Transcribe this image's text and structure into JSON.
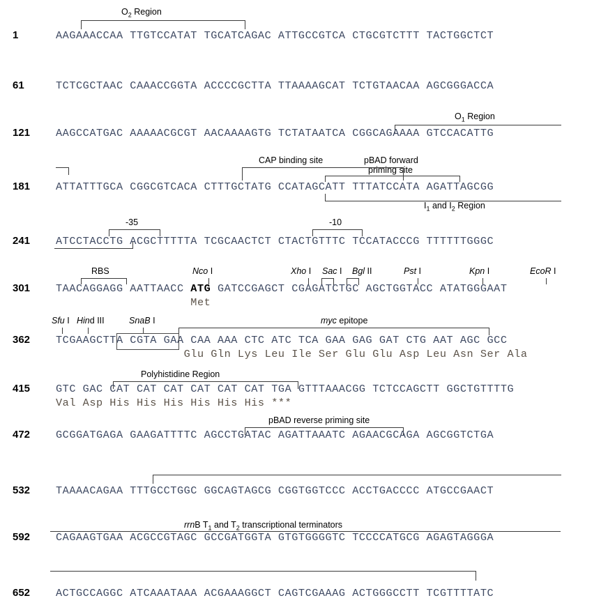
{
  "document": {
    "type": "dna-sequence-map",
    "title": "pBAD vector multiple cloning site sequence"
  },
  "sequence_lines": [
    {
      "number": "1",
      "bases": "AAGAAACCAA TTGTCCATAT TGCATCAGAC ATTGCCGTCA CTGCGTCTTT TACTGGCTCT"
    },
    {
      "number": "61",
      "bases": "TCTCGCTAAC CAAACCGGTA ACCCCGCTTA TTAAAAGCAT TCTGTAACAA AGCGGGACCA"
    },
    {
      "number": "121",
      "bases": "AAGCCATGAC AAAAACGCGT AACAAAAGTG TCTATAATCA CGGCAGAAAA GTCCACATTG"
    },
    {
      "number": "181",
      "bases": "ATTATTTGCA CGGCGTCACA CTTTGCTATG CCATAGCATT TTTATCCATA AGATTAGCGG"
    },
    {
      "number": "241",
      "bases": "ATCCTACCTG ACGCTTTTTA TCGCAACTCT CTACTGTTTC TCCATACCCG TTTTTTGGGC"
    },
    {
      "number": "301",
      "bases_html": "TAACAGGAGG AATTAACC <b>ATG</b> GATCCGAGCT CGAGATCTGC AGCTGGTACC ATATGGGAAT",
      "bases": "TAACAGGAGG AATTAACC ATG GATCCGAGCT CGAGATCTGC AGCTGGTACC ATATGGGAAT",
      "amino_acids": "                    Met"
    },
    {
      "number": "362",
      "bases": "TCGAAGCTTA CGTA GAA CAA AAA CTC ATC TCA GAA GAG GAT CTG AAT AGC GCC",
      "amino_acids": "                   Glu Gln Lys Leu Ile Ser Glu Glu Asp Leu Asn Ser Ala"
    },
    {
      "number": "415",
      "bases": "GTC GAC CAT CAT CAT CAT CAT CAT TGA GTTTAAACGG TCTCCAGCTT GGCTGTTTTG",
      "amino_acids": "Val Asp His His His His His His ***"
    },
    {
      "number": "472",
      "bases": "GCGGATGAGA GAAGATTTTC AGCCTGATAC AGATTAAATC AGAACGCAGA AGCGGTCTGA"
    },
    {
      "number": "532",
      "bases": "TAAAACAGAA TTTGCCTGGC GGCAGTAGCG CGGTGGTCCC ACCTGACCCC ATGCCGAACT"
    },
    {
      "number": "592",
      "bases": "CAGAAGTGAA ACGCCGTAGC GCCGATGGTA GTGTGGGGTC TCCCCATGCG AGAGTAGGGA"
    },
    {
      "number": "652",
      "bases": "ACTGCCAGGC ATCAAATAAA ACGAAAGGCT CAGTCGAAAG ACTGGGCCTT TCGTTTTATC"
    }
  ],
  "annotations": {
    "o2_region": "O₂ Region",
    "o2_region_parts": {
      "pre": "O",
      "sub": "2",
      "post": " Region"
    },
    "o1_region_parts": {
      "pre": "O",
      "sub": "1",
      "post": " Region"
    },
    "cap_binding_site": "CAP binding site",
    "pbad_forward_line1": "pBAD forward",
    "pbad_forward_line2": "priming site",
    "i1_i2_region_parts": {
      "pre": "I",
      "sub1": "1",
      "mid": " and I",
      "sub2": "2",
      "post": " Region"
    },
    "minus35": "-35",
    "minus10": "-10",
    "rbs": "RBS",
    "myc_epitope_italic": "myc",
    "myc_epitope_rest": " epitope",
    "polyhistidine_region": "Polyhistidine Region",
    "pbad_reverse_priming_site": "pBAD reverse priming site",
    "terminators_parts": {
      "italic": "rrn",
      "p1": "B T",
      "sub1": "1",
      "p2": " and T",
      "sub2": "2",
      "p3": " transcriptional terminators"
    }
  },
  "restriction_sites": [
    {
      "name_italic": "Nco",
      "name_rest": " I"
    },
    {
      "name_italic": "Xho",
      "name_rest": " I"
    },
    {
      "name_italic": "Sac",
      "name_rest": " I"
    },
    {
      "name_italic": "Bgl",
      "name_rest": " II"
    },
    {
      "name_italic": "Pst",
      "name_rest": " I"
    },
    {
      "name_italic": "Kpn",
      "name_rest": " I"
    },
    {
      "name_italic": "EcoR",
      "name_rest": " I"
    },
    {
      "name_italic": "Sfu",
      "name_rest": " I"
    },
    {
      "name_italic": "Hin",
      "name_rest": "d III"
    },
    {
      "name_italic": "SnaB",
      "name_rest": " I"
    }
  ],
  "colors": {
    "text": "#3f4a63",
    "amino": "#5b5248",
    "line": "#3a3a3a",
    "number": "#000000"
  }
}
